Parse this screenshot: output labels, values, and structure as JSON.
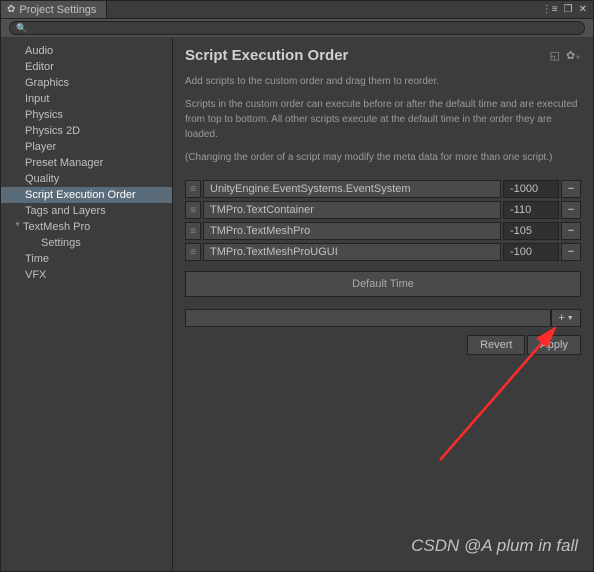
{
  "window": {
    "title": "Project Settings",
    "controls": {
      "menu": "⋮≡",
      "popout": "❐",
      "close": "✕"
    }
  },
  "search": {
    "placeholder": ""
  },
  "sidebar": {
    "items": [
      {
        "label": "Audio",
        "selected": false
      },
      {
        "label": "Editor",
        "selected": false
      },
      {
        "label": "Graphics",
        "selected": false
      },
      {
        "label": "Input",
        "selected": false
      },
      {
        "label": "Physics",
        "selected": false
      },
      {
        "label": "Physics 2D",
        "selected": false
      },
      {
        "label": "Player",
        "selected": false
      },
      {
        "label": "Preset Manager",
        "selected": false
      },
      {
        "label": "Quality",
        "selected": false
      },
      {
        "label": "Script Execution Order",
        "selected": true
      },
      {
        "label": "Tags and Layers",
        "selected": false
      },
      {
        "label": "TextMesh Pro",
        "selected": false,
        "parent": true
      },
      {
        "label": "Settings",
        "selected": false,
        "child": true
      },
      {
        "label": "Time",
        "selected": false
      },
      {
        "label": "VFX",
        "selected": false
      }
    ]
  },
  "panel": {
    "title": "Script Execution Order",
    "desc1": "Add scripts to the custom order and drag them to reorder.",
    "desc2": "Scripts in the custom order can execute before or after the default time and are executed from top to bottom. All other scripts execute at the default time in the order they are loaded.",
    "desc3": "(Changing the order of a script may modify the meta data for more than one script.)",
    "scripts": [
      {
        "name": "UnityEngine.EventSystems.EventSystem",
        "order": "-1000"
      },
      {
        "name": "TMPro.TextContainer",
        "order": "-110"
      },
      {
        "name": "TMPro.TextMeshPro",
        "order": "-105"
      },
      {
        "name": "TMPro.TextMeshProUGUI",
        "order": "-100"
      }
    ],
    "default_time_label": "Default Time",
    "add_icon": "+",
    "revert_label": "Revert",
    "apply_label": "Apply"
  },
  "watermark": "CSDN @A plum in fall"
}
